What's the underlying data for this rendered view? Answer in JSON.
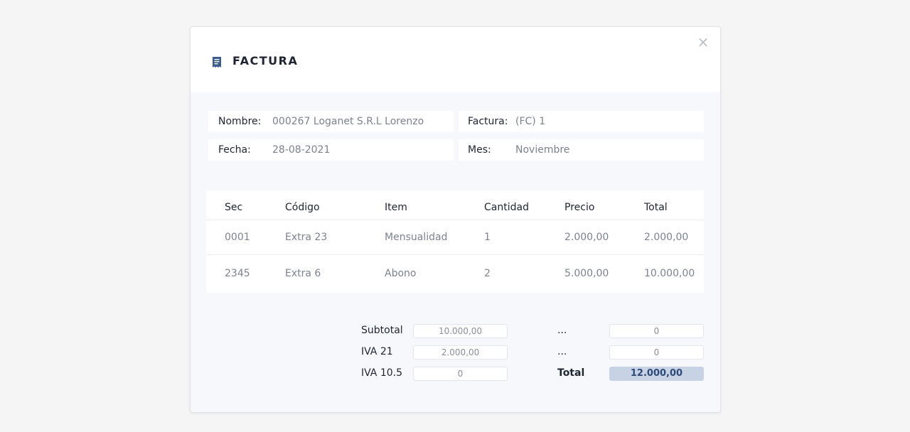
{
  "modal": {
    "title": "FACTURA",
    "close_label": "×",
    "title_icon": "receipt-icon"
  },
  "info": {
    "nombre_label": "Nombre:",
    "nombre_value": "000267 Loganet S.R.L Lorenzo",
    "factura_label": "Factura:",
    "factura_value": "(FC) 1",
    "fecha_label": "Fecha:",
    "fecha_value": "28-08-2021",
    "mes_label": "Mes:",
    "mes_value": "Noviembre"
  },
  "table": {
    "headers": [
      "Sec",
      "Código",
      "Item",
      "Cantidad",
      "Precio",
      "Total"
    ],
    "rows": [
      [
        "0001",
        "Extra 23",
        "Mensualidad",
        "1",
        "2.000,00",
        "2.000,00"
      ],
      [
        "2345",
        "Extra 6",
        "Abono",
        "2",
        "5.000,00",
        "10.000,00"
      ]
    ]
  },
  "totals": {
    "subtotal_label": "Subtotal",
    "subtotal_value": "10.000,00",
    "iva21_label": "IVA 21",
    "iva21_value": "2.000,00",
    "iva105_label": "IVA 10.5",
    "iva105_value": "0",
    "extra1_label": "...",
    "extra1_value": "0",
    "extra2_label": "...",
    "extra2_value": "0",
    "total_label": "Total",
    "total_value": "12.000,00"
  },
  "colors": {
    "accent": "#3b5b8f",
    "total_highlight": "#c7d3e5"
  }
}
